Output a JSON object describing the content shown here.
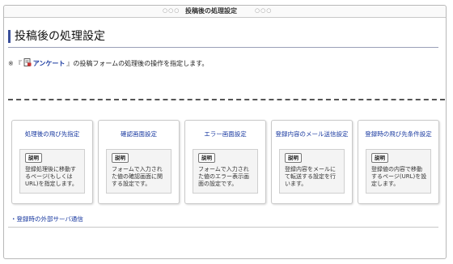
{
  "window": {
    "title": "投稿後の処理設定",
    "dots_left": "○○○",
    "dots_right": "○○○"
  },
  "page": {
    "heading": "投稿後の処理設定"
  },
  "description": {
    "star": "※",
    "open_bracket": "『",
    "form_name": "アンケート",
    "close_bracket": "』",
    "text": "の投稿フォームの処理後の操作を指定します。",
    "icon": "form-document-icon"
  },
  "cards": [
    {
      "title": "処理後の飛び先指定",
      "button": "説明",
      "text": "登録処理後に移動するページ(もしくはURL)を指定します。"
    },
    {
      "title": "確認画面設定",
      "button": "説明",
      "text": "フォームで入力された値の確認画面に関する設定です。"
    },
    {
      "title": "エラー画面設定",
      "button": "説明",
      "text": "フォームで入力された値のエラー表示画面の設定です。"
    },
    {
      "title": "登録内容のメール送信設定",
      "button": "説明",
      "text": "登録内容をメールにて転送する設定を行います。"
    },
    {
      "title": "登録時の飛び先条件設定",
      "button": "説明",
      "text": "登録値の内容で移動するページ(URL)を設定します。"
    }
  ],
  "footer": {
    "link": "・登録時の外部サーバ通信"
  },
  "colors": {
    "accent": "#3a4f9a",
    "link": "#1a3aa0"
  }
}
